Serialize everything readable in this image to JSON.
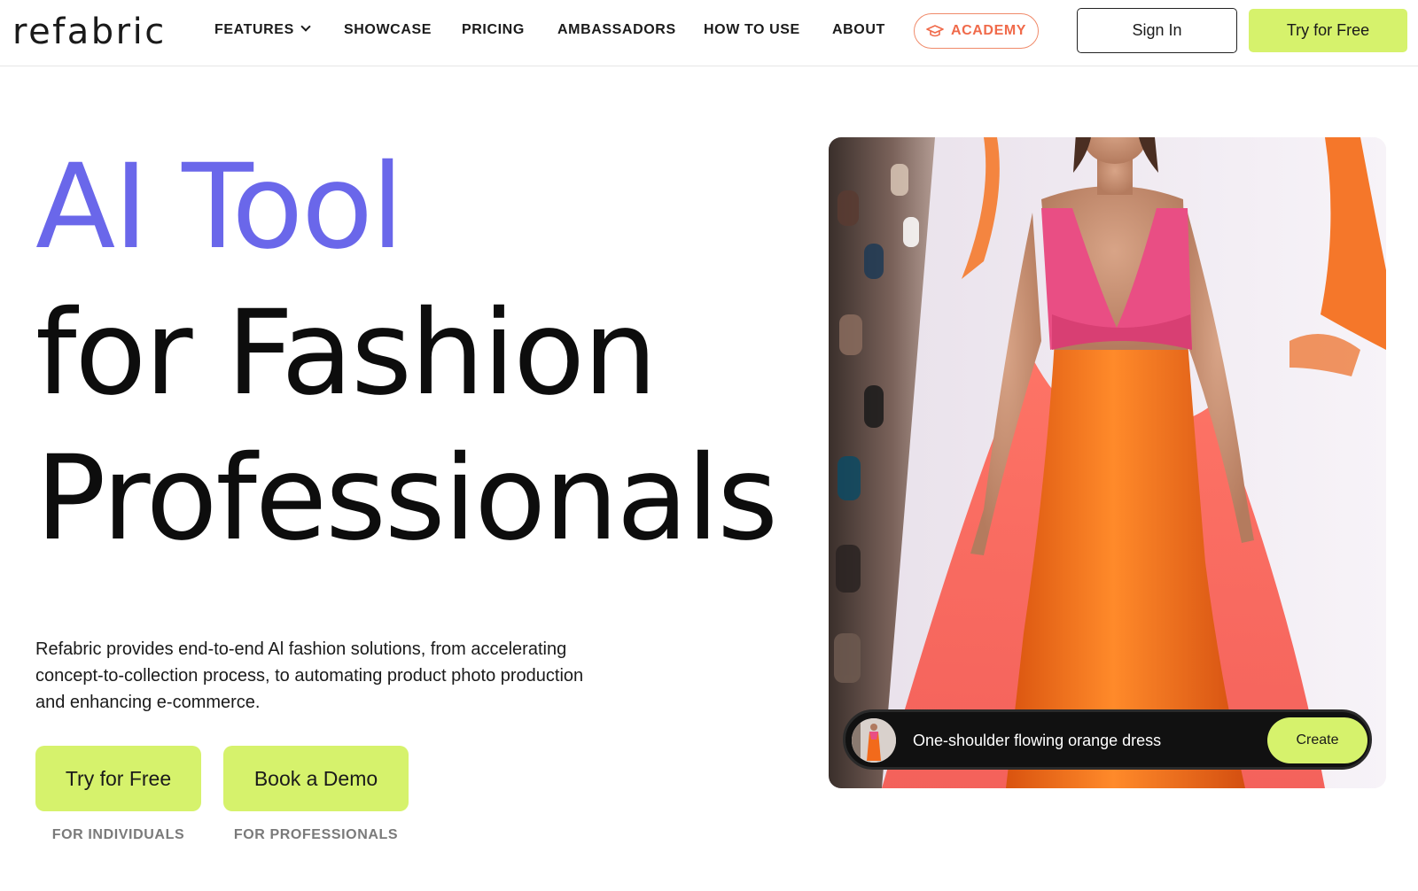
{
  "brand": {
    "logo_text": "refabric"
  },
  "nav": {
    "items": [
      {
        "label": "FEATURES"
      },
      {
        "label": "SHOWCASE"
      },
      {
        "label": "PRICING"
      },
      {
        "label": "AMBASSADORS"
      },
      {
        "label": "HOW TO USE"
      },
      {
        "label": "ABOUT"
      }
    ],
    "academy_label": "ACADEMY",
    "signin_label": "Sign In",
    "try_label": "Try for Free"
  },
  "hero": {
    "line1": "AI Tool",
    "line2": "for Fashion",
    "line3": "Professionals",
    "description": "Refabric provides end-to-end Al fashion solutions, from accelerating concept-to-collection process, to automating product photo production and enhancing e-commerce.",
    "cta_primary": {
      "label": "Try for Free",
      "sub": "FOR INDIVIDUALS"
    },
    "cta_secondary": {
      "label": "Book a Demo",
      "sub": "FOR PROFESSIONALS"
    }
  },
  "showcase": {
    "prompt_text": "One-shoulder flowing orange dress",
    "create_label": "Create"
  },
  "colors": {
    "accent_purple": "#6a67ea",
    "lime": "#d6f26c",
    "academy_orange": "#f06a4a",
    "dress_orange": "#f26a1b",
    "dress_pink": "#e94e84"
  },
  "icons": {
    "academy": "graduation-cap-icon",
    "features_dropdown": "chevron-down-icon"
  }
}
